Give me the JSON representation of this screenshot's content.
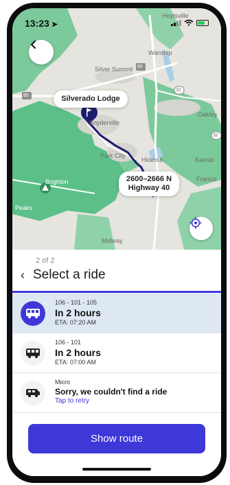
{
  "status_bar": {
    "time": "13:23",
    "location_icon": "location-arrow-icon"
  },
  "map": {
    "towns": [
      "Hoytsville",
      "Wanship",
      "Silver Summit",
      "Snyderville",
      "Oakley",
      "Park City",
      "Hideout",
      "Kamas",
      "Brighton",
      "Francis",
      "Peaks",
      "Midway"
    ],
    "road_shields": [
      "80",
      "80",
      "32",
      "32"
    ],
    "origin_label": "Silverado Lodge",
    "destination_label_line1": "2600–2666 N",
    "destination_label_line2": "Highway 40",
    "route_color": "#1c1c6e",
    "forest_color": "#5bbf87",
    "accent_color": "#3f38d9"
  },
  "sheet": {
    "step": "2 of 2",
    "title": "Select a ride",
    "rides": [
      {
        "route": "106 - 101 - 105",
        "when": "In 2 hours",
        "eta": "ETA: 07:20 AM",
        "icon": "bus-icon",
        "selected": true
      },
      {
        "route": "106 - 101",
        "when": "In 2 hours",
        "eta": "ETA: 07:00 AM",
        "icon": "bus-icon",
        "selected": false
      },
      {
        "route": "Micro",
        "message": "Sorry, we couldn't find a ride",
        "retry": "Tap to retry",
        "icon": "van-icon"
      }
    ],
    "primary_button": "Show route"
  }
}
